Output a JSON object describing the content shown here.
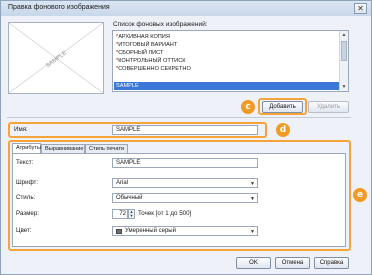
{
  "window": {
    "title": "Правка фонового изображения",
    "close_glyph": "✕"
  },
  "list": {
    "label": "Список фоновых изображений:",
    "items": [
      {
        "label": "АРХИВНАЯ КОПИЯ",
        "marked": true
      },
      {
        "label": "ИТОГОВЫЙ ВАРИАНТ",
        "marked": true
      },
      {
        "label": "СБОРНЫЙ ЛИСТ",
        "marked": true
      },
      {
        "label": "КОНТРОЛЬНЫЙ ОТТИСК",
        "marked": true
      },
      {
        "label": "СОВЕРШЕННО СЕКРЕТНО",
        "marked": true
      },
      {
        "label": "SAMPLE",
        "marked": false,
        "selected": true
      }
    ],
    "star": "*"
  },
  "preview": {
    "watermark_text": "SAMPLE"
  },
  "buttons": {
    "add": "Добавить",
    "delete": "Удалить",
    "ok": "OK",
    "cancel": "Отмена",
    "help": "Справка"
  },
  "name_field": {
    "label": "Имя:",
    "value": "SAMPLE"
  },
  "tabs": [
    {
      "label": "Атрибуты",
      "active": true
    },
    {
      "label": "Выравнивание",
      "active": false
    },
    {
      "label": "Стиль печати",
      "active": false
    }
  ],
  "attributes": {
    "text_label": "Текст:",
    "text_value": "SAMPLE",
    "font_label": "Шрифт:",
    "font_value": "Arial",
    "style_label": "Стиль:",
    "style_value": "Обычный",
    "size_label": "Размер:",
    "size_value": "72",
    "size_hint": "Точек [от 1 до 500]",
    "color_label": "Цвет:",
    "color_value": "Умеренный серый"
  },
  "callouts": {
    "c": "c",
    "d": "d",
    "e": "e"
  },
  "colors": {
    "accent": "#f19a24",
    "selection": "#3b78d8",
    "swatch": "#707070"
  },
  "icons": {
    "spin_up": "▲",
    "spin_down": "▼",
    "caret": "▼",
    "scroll_up": "▲",
    "scroll_down": "▼"
  }
}
